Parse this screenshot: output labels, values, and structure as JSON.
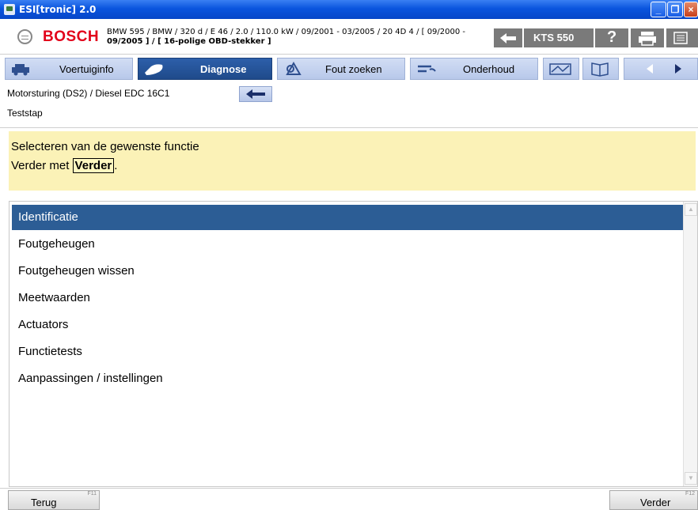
{
  "window": {
    "title": "ESI[tronic] 2.0"
  },
  "header": {
    "brand": "BOSCH",
    "vehicle_line1": "BMW 595 / BMW / 320 d / E 46 / 2.0 / 110.0 kW / 09/2001 - 03/2005 / 20 4D 4 / [ 09/2000 -",
    "vehicle_line2": "09/2005 ] / [ 16-polige OBD-stekker ]",
    "device_label": "KTS 550"
  },
  "tabs": [
    {
      "label": "Voertuiginfo",
      "active": false,
      "icon": "vehicle-info-icon"
    },
    {
      "label": "Diagnose",
      "active": true,
      "icon": "diagnose-plug-icon"
    },
    {
      "label": "Fout zoeken",
      "active": false,
      "icon": "troubleshoot-icon"
    },
    {
      "label": "Onderhoud",
      "active": false,
      "icon": "maintenance-icon"
    }
  ],
  "breadcrumb": {
    "path": "Motorsturing (DS2) / Diesel EDC 16C1",
    "step": "Teststap"
  },
  "info": {
    "line1": "Selecteren van de gewenste functie",
    "line2_prefix": "Verder met ",
    "line2_button": "Verder",
    "line2_suffix": "."
  },
  "functions": [
    "Identificatie",
    "Foutgeheugen",
    "Foutgeheugen wissen",
    "Meetwaarden",
    "Actuators",
    "Functietests",
    "Aanpassingen / instellingen"
  ],
  "footer": {
    "back_label": "Terug",
    "back_key": "F11",
    "next_label": "Verder",
    "next_key": "F12"
  },
  "colors": {
    "titlebar": "#0a55de",
    "active_tab": "#2d5faa",
    "selected_item": "#2c5d95",
    "info_background": "#fbf2b7",
    "brand_red": "#e2001a"
  }
}
